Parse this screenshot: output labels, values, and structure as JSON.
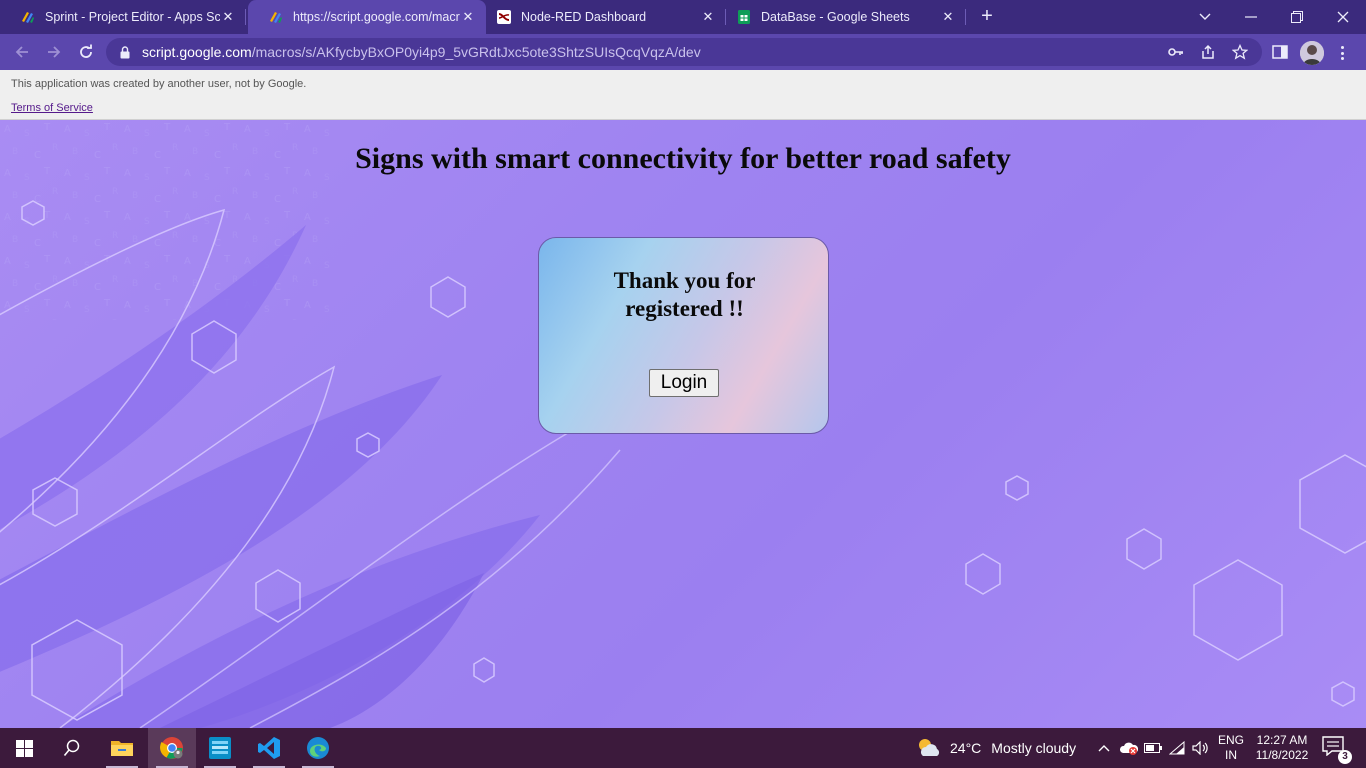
{
  "browser": {
    "tabs": [
      {
        "title": "Sprint - Project Editor - Apps Scri",
        "icon": "apps-script-icon",
        "active": false
      },
      {
        "title": "https://script.google.com/macros",
        "icon": "apps-script-icon",
        "active": true
      },
      {
        "title": "Node-RED Dashboard",
        "icon": "node-red-icon",
        "active": false
      },
      {
        "title": "DataBase - Google Sheets",
        "icon": "google-sheets-icon",
        "active": false
      }
    ],
    "url_host": "script.google.com",
    "url_path": "/macros/s/AKfycbyBxOP0yi4p9_5vGRdtJxc5ote3ShtzSUIsQcqVqzA/dev"
  },
  "banner": {
    "warning": "This application was created by another user, not by Google.",
    "terms_link": "Terms of Service"
  },
  "page": {
    "title": "Signs with smart connectivity for better road safety",
    "card": {
      "message_line1": "Thank you for",
      "message_line2": "registered !!",
      "login_button": "Login"
    }
  },
  "taskbar": {
    "weather_temp": "24°C",
    "weather_condition": "Mostly cloudy",
    "lang_line1": "ENG",
    "lang_line2": "IN",
    "time": "12:27 AM",
    "date": "11/8/2022",
    "notification_count": "3"
  },
  "colors": {
    "tabstrip": "#3b2a7d",
    "toolbar": "#5b47ad",
    "page_bg": "#a089f2",
    "taskbar": "#3c1a3c"
  }
}
